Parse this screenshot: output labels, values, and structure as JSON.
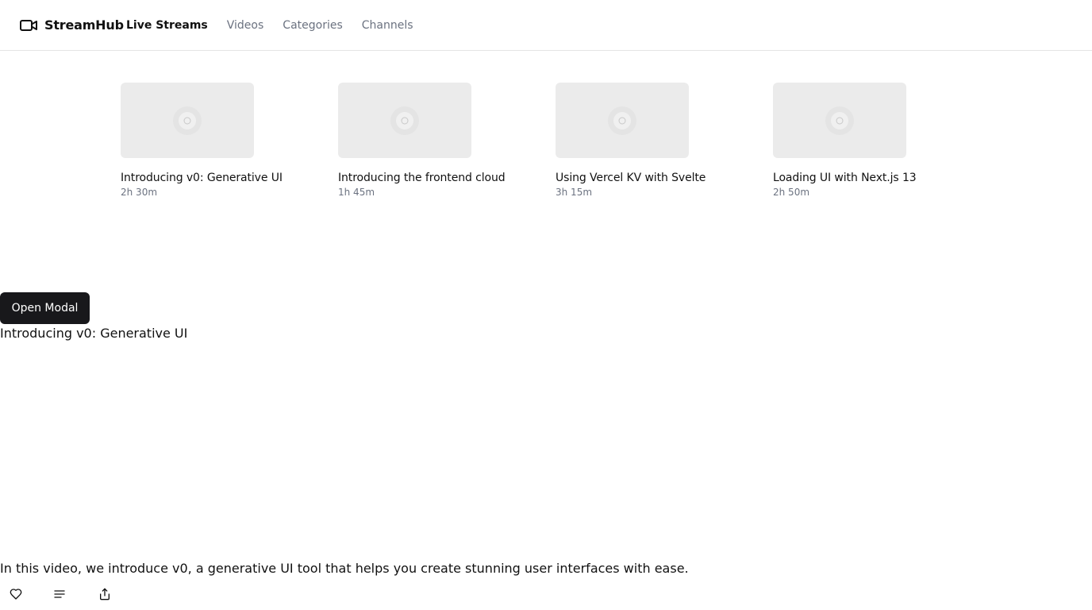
{
  "brand": {
    "name": "StreamHub",
    "icon": "video-camera-icon"
  },
  "nav": {
    "items": [
      {
        "label": "Live Streams",
        "active": true
      },
      {
        "label": "Videos",
        "active": false
      },
      {
        "label": "Categories",
        "active": false
      },
      {
        "label": "Channels",
        "active": false
      }
    ]
  },
  "videos": [
    {
      "title": "Introducing v0: Generative UI",
      "duration": "2h 30m"
    },
    {
      "title": "Introducing the frontend cloud",
      "duration": "1h 45m"
    },
    {
      "title": "Using Vercel KV with Svelte",
      "duration": "3h 15m"
    },
    {
      "title": "Loading UI with Next.js 13",
      "duration": "2h 50m"
    }
  ],
  "modal": {
    "open_button_label": "Open Modal",
    "title": "Introducing v0: Generative UI",
    "description": "In this video, we introduce v0, a generative UI tool that helps you create stunning user interfaces with ease."
  },
  "actions": [
    {
      "icon": "heart-icon"
    },
    {
      "icon": "list-icon"
    },
    {
      "icon": "share-icon"
    }
  ],
  "colors": {
    "primary_button": "#18181b",
    "thumbnail_bg": "#ebebeb",
    "muted_text": "#6b7280"
  }
}
